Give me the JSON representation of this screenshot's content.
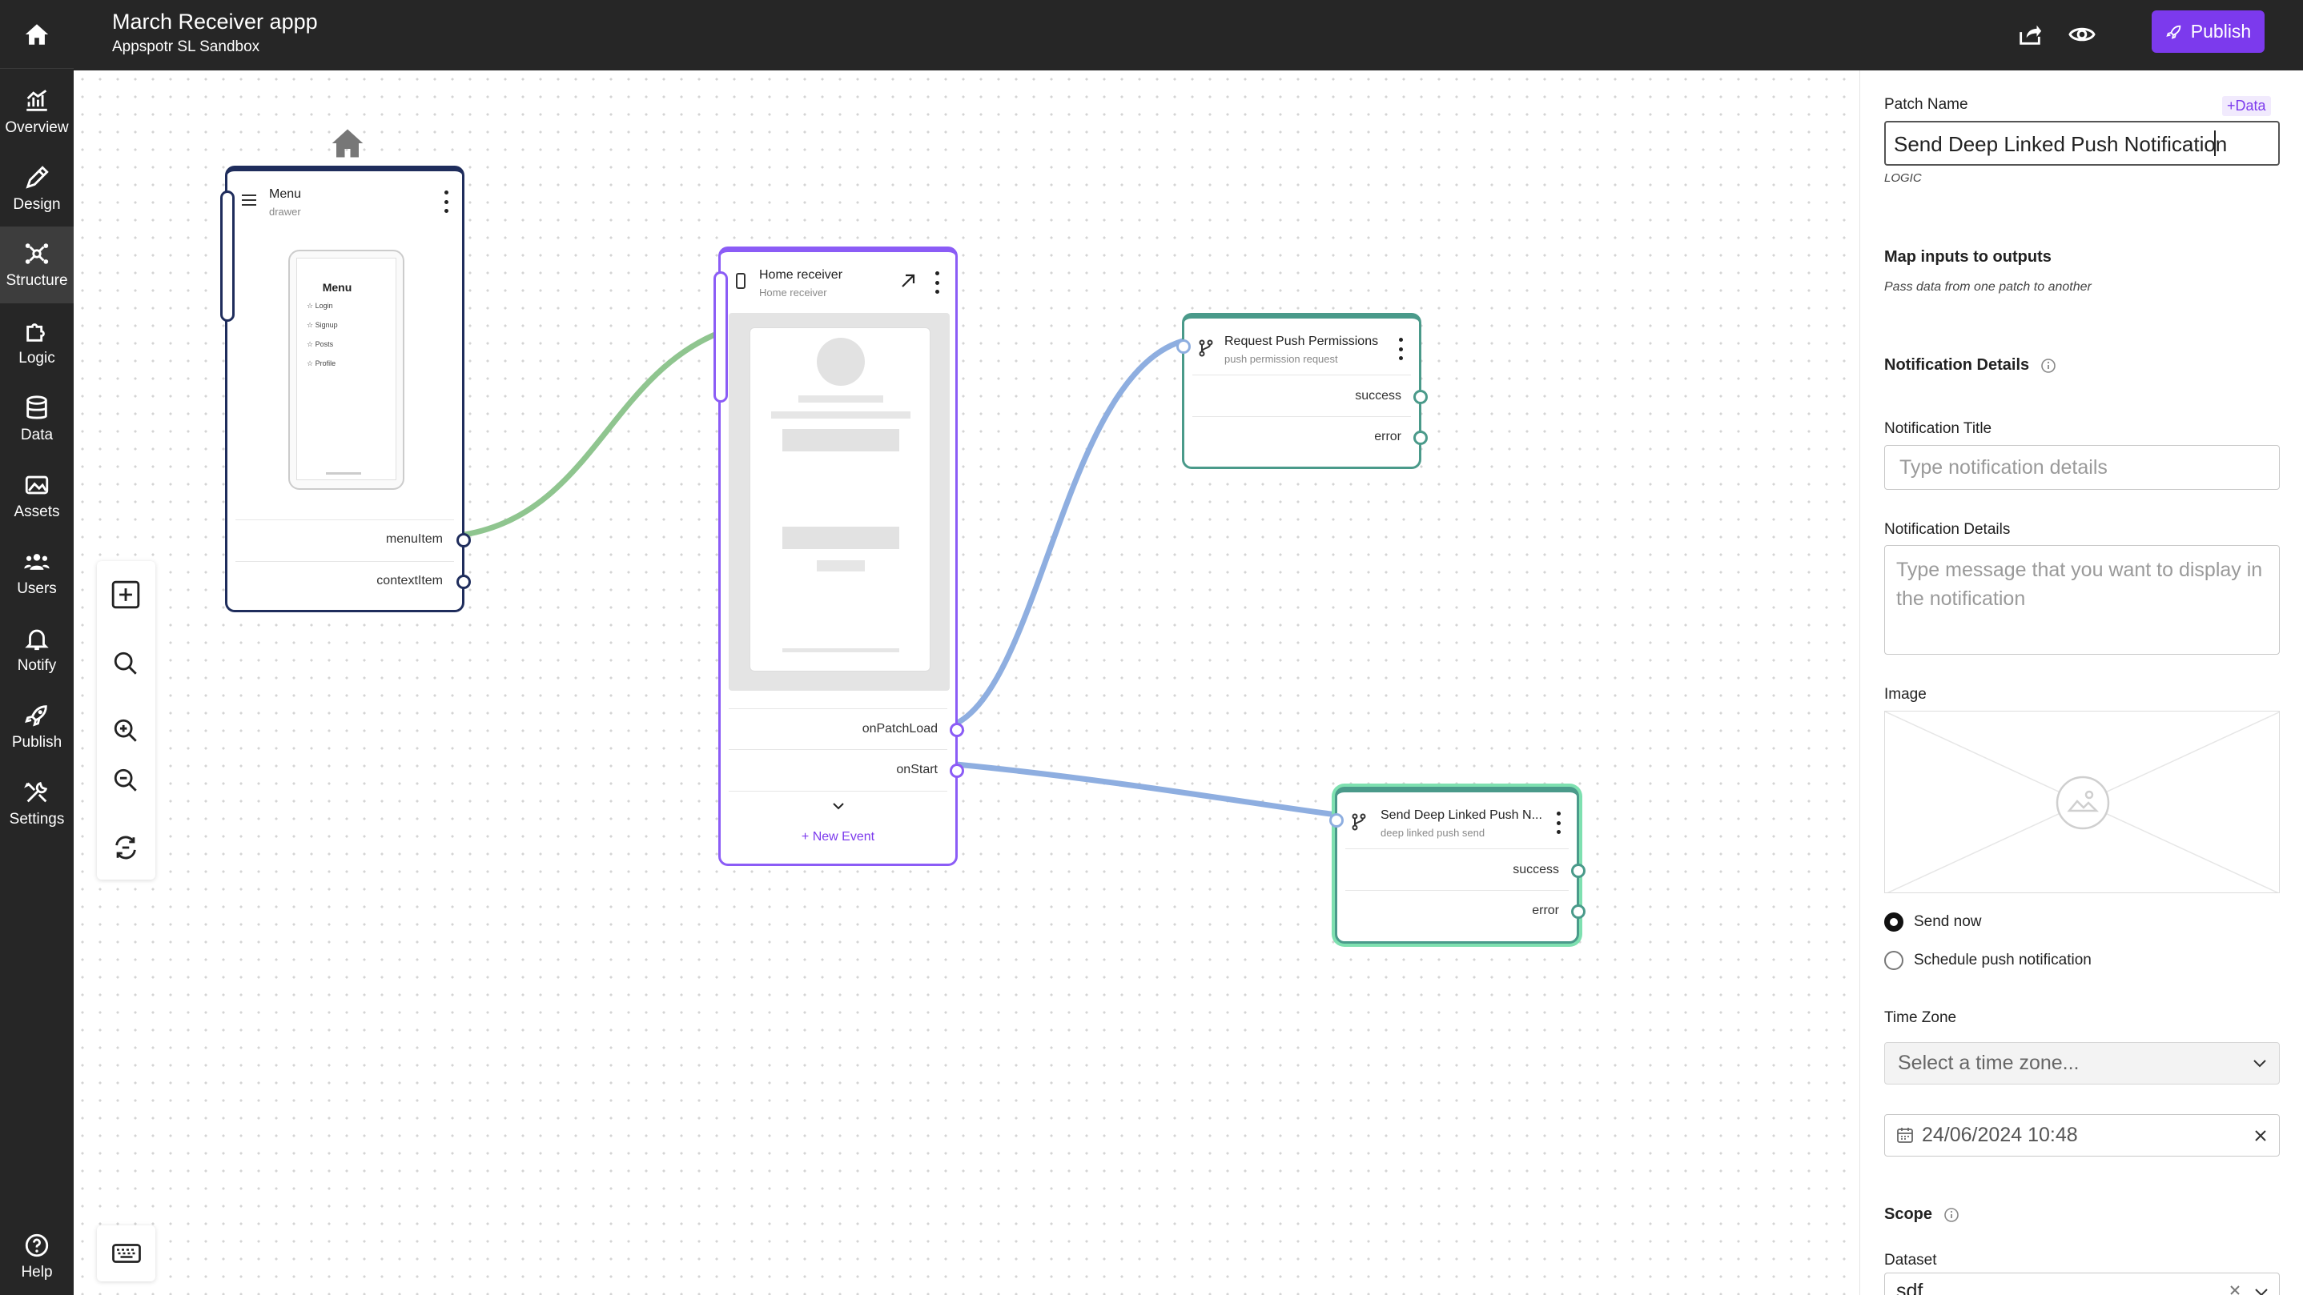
{
  "app": {
    "title": "March Receiver appp",
    "subtitle": "Appspotr SL Sandbox"
  },
  "topbar": {
    "publish_label": "Publish"
  },
  "sidebar": {
    "items": [
      {
        "label": "Overview",
        "icon": "chart-icon"
      },
      {
        "label": "Design",
        "icon": "pencil-icon"
      },
      {
        "label": "Structure",
        "icon": "structure-icon",
        "active": true
      },
      {
        "label": "Logic",
        "icon": "puzzle-icon"
      },
      {
        "label": "Data",
        "icon": "database-icon"
      },
      {
        "label": "Assets",
        "icon": "image-icon"
      },
      {
        "label": "Users",
        "icon": "users-icon"
      },
      {
        "label": "Notify",
        "icon": "bell-icon"
      },
      {
        "label": "Publish",
        "icon": "rocket-icon"
      },
      {
        "label": "Settings",
        "icon": "tools-icon"
      }
    ],
    "help_label": "Help"
  },
  "nodes": {
    "menu": {
      "title": "Menu",
      "subtitle": "drawer",
      "preview_title": "Menu",
      "preview_items": [
        "Login",
        "Signup",
        "Posts",
        "Profile"
      ],
      "ports": [
        "menuItem",
        "contextItem"
      ]
    },
    "home": {
      "title": "Home receiver",
      "subtitle": "Home receiver",
      "ports": [
        "onPatchLoad",
        "onStart"
      ],
      "new_event": "+ New Event"
    },
    "push_perm": {
      "title": "Request Push Permissions",
      "subtitle": "push permission request",
      "ports": [
        "success",
        "error"
      ]
    },
    "deep_push": {
      "title": "Send Deep Linked Push N...",
      "subtitle": "deep linked push send",
      "ports": [
        "success",
        "error"
      ]
    }
  },
  "panel": {
    "patch_name_label": "Patch Name",
    "data_link": "+Data",
    "patch_name_value": "Send Deep Linked Push Notification",
    "type_tag": "LOGIC",
    "map_heading": "Map inputs to outputs",
    "map_desc": "Pass data from one patch to another",
    "details_heading": "Notification Details",
    "title_label": "Notification Title",
    "title_placeholder": "Type notification details",
    "details_label": "Notification Details",
    "details_placeholder": "Type message that you want to display in the notification",
    "image_label": "Image",
    "send_now": "Send now",
    "schedule": "Schedule push notification",
    "timezone_label": "Time Zone",
    "timezone_placeholder": "Select a time zone...",
    "datetime": "24/06/2024 10:48",
    "scope_heading": "Scope",
    "dataset_label": "Dataset",
    "dataset_value": "sdf"
  },
  "colors": {
    "accent": "#7c3aed",
    "wire_green": "#8fc58f",
    "wire_blue": "#8eaee0",
    "node_navy": "#1f2d5c",
    "node_teal": "#4a9a8a",
    "node_selected": "#5fd39a"
  }
}
